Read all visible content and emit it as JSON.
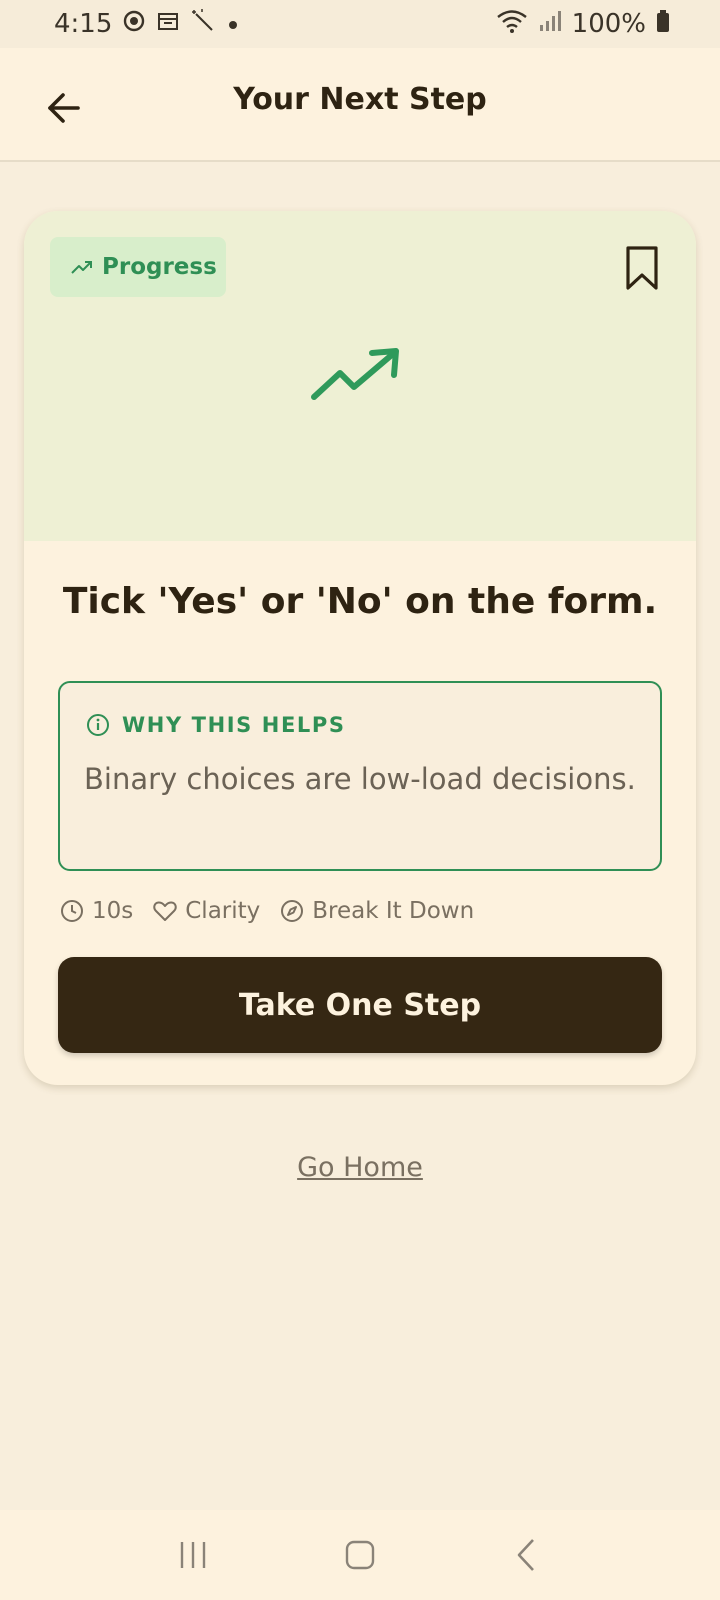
{
  "status_bar": {
    "time": "4:15",
    "battery": "100%"
  },
  "app_bar": {
    "title": "Your Next Step"
  },
  "card": {
    "tag_label": "Progress",
    "step_title": "Tick 'Yes' or 'No' on the form.",
    "why": {
      "heading": "WHY THIS HELPS",
      "text": "Binary choices are low-load decisions."
    },
    "meta": {
      "duration": "10s",
      "benefit": "Clarity",
      "strategy": "Break It Down"
    },
    "primary_button": "Take One Step"
  },
  "footer_link": "Go Home",
  "colors": {
    "accent_green": "#2f8f55",
    "dark_brown": "#352713",
    "background": "#f8eedc"
  },
  "icons": [
    "back-arrow-icon",
    "trending-up-icon",
    "bookmark-icon",
    "info-icon",
    "clock-icon",
    "heart-icon",
    "compass-icon"
  ]
}
